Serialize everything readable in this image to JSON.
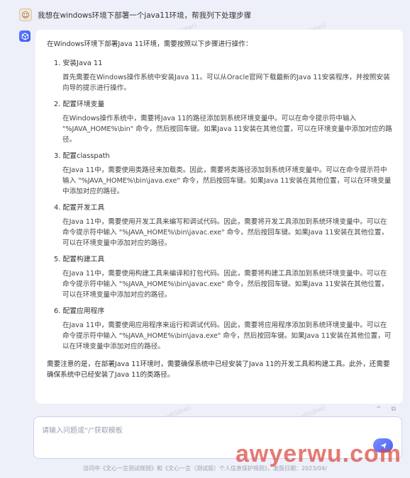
{
  "question": {
    "avatar_icon": "user-avatar-icon",
    "text": "我想在windows环境下部署一个java11环境，帮我列下处理步骤"
  },
  "answer": {
    "bot_icon": "cube-icon",
    "intro": "在Windows环境下部署Java 11环境，需要按照以下步骤进行操作：",
    "steps": [
      {
        "title": "1. 安装Java 11",
        "body": "首先需要在Windows操作系统中安装Java 11。可以从Oracle官网下载最新的Java 11安装程序，并按照安装向导的提示进行操作。"
      },
      {
        "title": "2. 配置环境变量",
        "body": "在Windows操作系统中，需要将Java 11的路径添加到系统环境变量中。可以在命令提示符中输入 \"%JAVA_HOME%\\bin\" 命令，然后按回车键。如果Java 11安装在其他位置，可以在环境变量中添加对应的路径。"
      },
      {
        "title": "3. 配置classpath",
        "body": "在Java 11中，需要使用类路径来加载类。因此，需要将类路径添加到系统环境变量中。可以在命令提示符中输入 \"%JAVA_HOME%\\bin\\java.exe\" 命令，然后按回车键。如果Java 11安装在其他位置，可以在环境变量中添加对应的路径。"
      },
      {
        "title": "4. 配置开发工具",
        "body": "在Java 11中，需要使用开发工具来编写和调试代码。因此，需要将开发工具添加到系统环境变量中。可以在命令提示符中输入 \"%JAVA_HOME%\\bin\\javac.exe\" 命令，然后按回车键。如果Java 11安装在其他位置，可以在环境变量中添加对应的路径。"
      },
      {
        "title": "5. 配置构建工具",
        "body": "在Java 11中，需要使用构建工具来编译和打包代码。因此，需要将构建工具添加到系统环境变量中。可以在命令提示符中输入 \"%JAVA_HOME%\\bin\\javac.exe\" 命令，然后按回车键。如果Java 11安装在其他位置，可以在环境变量中添加对应的路径。"
      },
      {
        "title": "6. 配置应用程序",
        "body": "在Java 11中，需要使用应用程序来运行和调试代码。因此，需要将应用程序添加到系统环境变量中。可以在命令提示符中输入 \"%JAVA_HOME%\\bin\\java.exe\" 命令，然后按回车键。如果Java 11安装在其他位置，可以在环境变量中添加对应的路径。"
      }
    ],
    "outro": "需要注意的是，在部署Java 11环境时，需要确保系统中已经安装了Java 11的开发工具和构建工具。此外，还需要确保系统中已经安装了Java 11的类路径。"
  },
  "input": {
    "placeholder": "请输入问题或“/”获取模板",
    "send_icon": "send-icon"
  },
  "footer": {
    "text": "访问中《文心一言测试规则》和《文心一言（测试版）个人信息保护规则》，发版日期：2023/04/"
  },
  "watermark": {
    "text": "seEGj6wG",
    "brand": "awyerwu.com",
    "brand_color": "#dc463c"
  },
  "colors": {
    "accent": "#4a63f5",
    "page_bg": "#eef0f9",
    "card_bg": "#ffffff"
  }
}
